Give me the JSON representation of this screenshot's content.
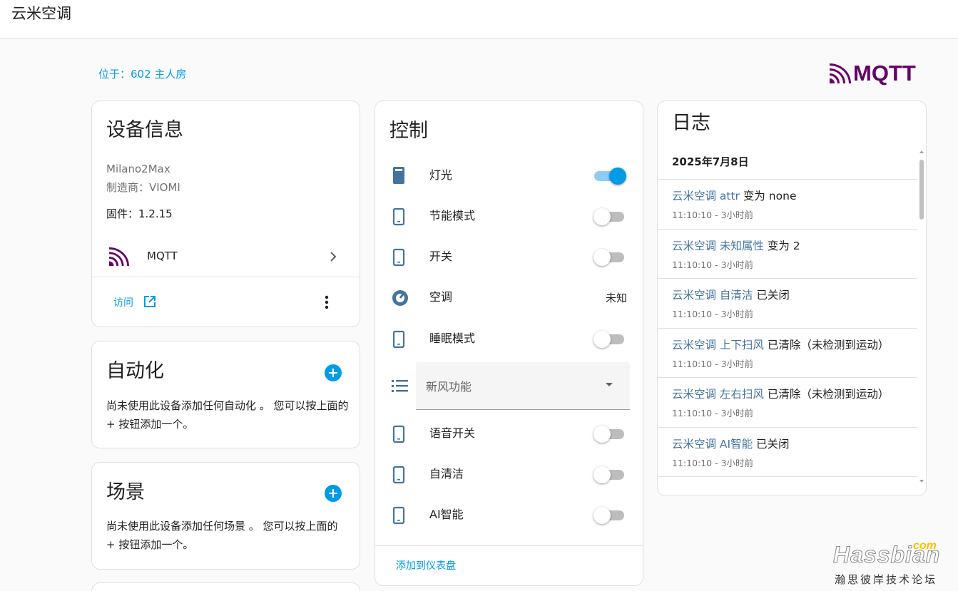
{
  "app": {
    "title": "云米空调"
  },
  "location": "位于：602 主人房",
  "mqtt_logo": {
    "wordmark": "MQTT",
    "color": "#660066"
  },
  "device_info": {
    "title": "设备信息",
    "model": "Milano2Max",
    "manufacturer": "制造商：VIOMI",
    "firmware": "固件：1.2.15",
    "integration": "MQTT",
    "visit": "访问"
  },
  "automation": {
    "title": "自动化",
    "text": "尚未使用此设备添加任何自动化 。 您可以按上面的 + 按钮添加一个。"
  },
  "scene": {
    "title": "场景",
    "text": "尚未使用此设备添加任何场景 。 您可以按上面的 + 按钮添加一个。"
  },
  "controls": {
    "title": "控制",
    "rows": [
      {
        "label": "灯光",
        "state": "on"
      },
      {
        "label": "节能模式",
        "state": "off"
      },
      {
        "label": "开关",
        "state": "off"
      },
      {
        "label": "空调",
        "value": "未知"
      },
      {
        "label": "睡眠模式",
        "state": "off"
      },
      {
        "label": "新风功能"
      },
      {
        "label": "语音开关",
        "state": "off"
      },
      {
        "label": "自清洁",
        "state": "off"
      },
      {
        "label": "AI智能",
        "state": "off"
      }
    ],
    "add_to_dashboard": "添加到仪表盘"
  },
  "logbook": {
    "title": "日志",
    "date": "2025年7月8日",
    "entries": [
      {
        "entity": "云米空调 attr",
        "message": " 变为 none",
        "time": "11:10:10 - 3小时前"
      },
      {
        "entity": "云米空调 未知属性",
        "message": " 变为 2",
        "time": "11:10:10 - 3小时前"
      },
      {
        "entity": "云米空调 自清洁",
        "message": " 已关闭",
        "time": "11:10:10 - 3小时前"
      },
      {
        "entity": "云米空调 上下扫风",
        "message": " 已清除（未检测到运动）",
        "time": "11:10:10 - 3小时前"
      },
      {
        "entity": "云米空调 左右扫风",
        "message": " 已清除（未检测到运动）",
        "time": "11:10:10 - 3小时前"
      },
      {
        "entity": "云米空调 AI智能",
        "message": " 已关闭",
        "time": "11:10:10 - 3小时前"
      }
    ]
  },
  "watermark": {
    "brand": "Hassbian",
    "suffix": "com",
    "subtitle": "瀚思彼岸技术论坛"
  },
  "colors": {
    "accent": "#039be5",
    "icon": "#44739e",
    "mqtt": "#660066"
  }
}
